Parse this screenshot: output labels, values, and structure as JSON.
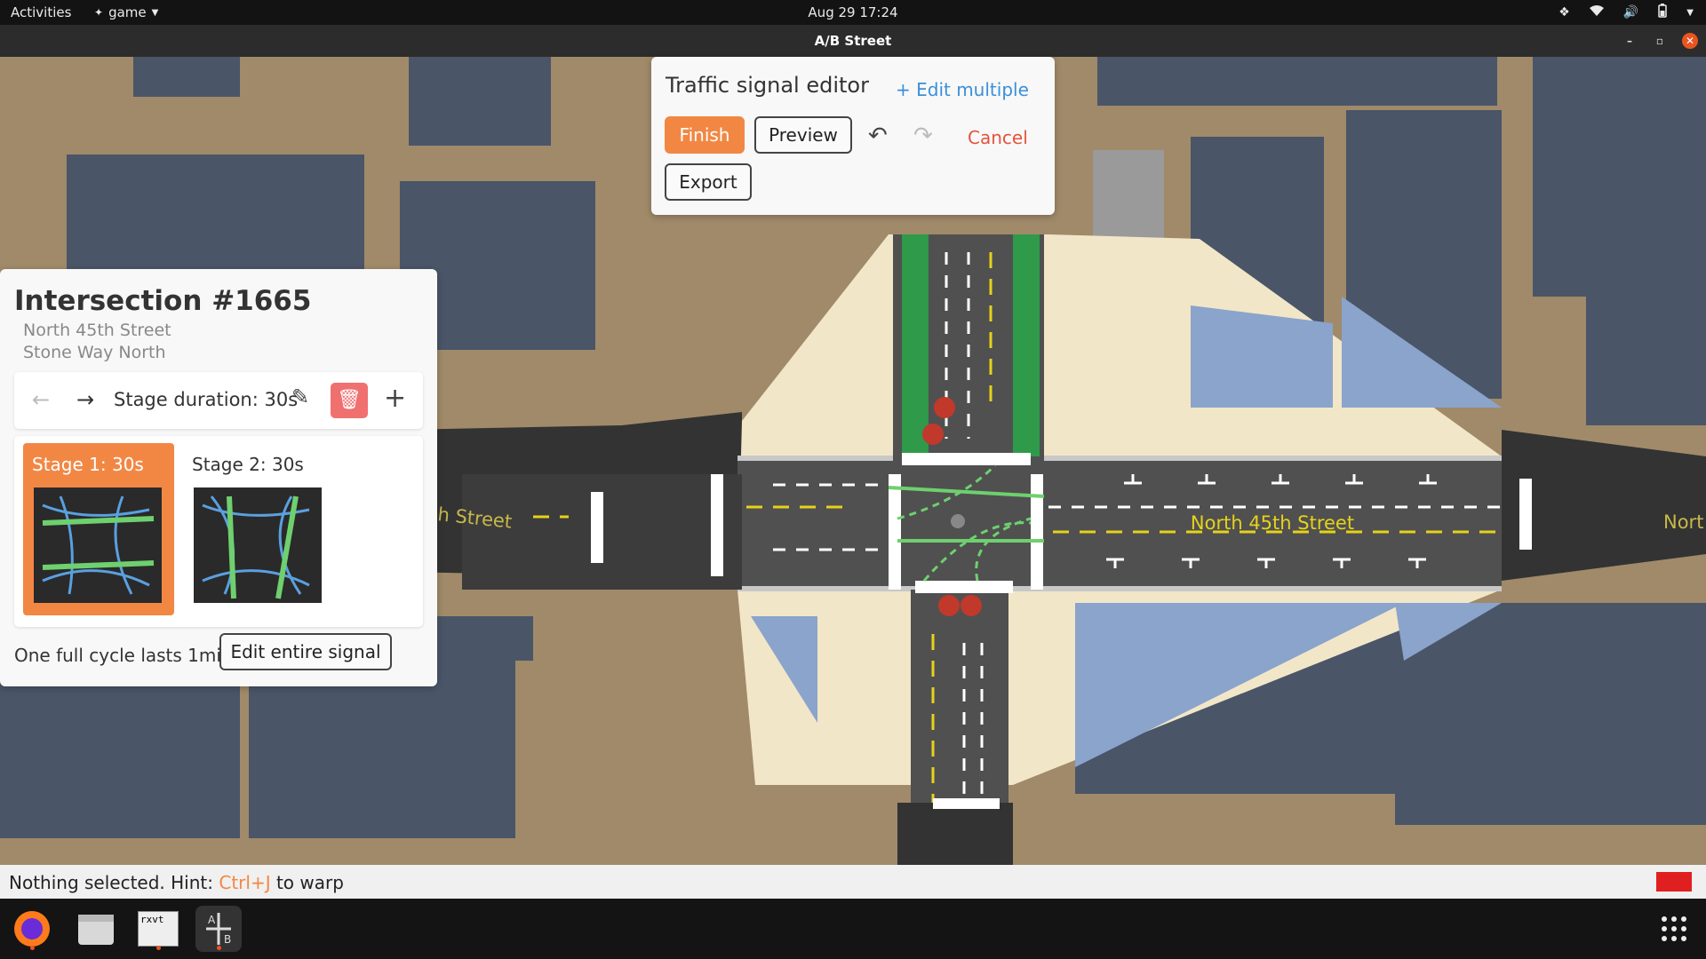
{
  "topbar": {
    "activities": "Activities",
    "app_name": "game",
    "clock": "Aug 29  17:24"
  },
  "window": {
    "title": "A/B Street"
  },
  "map": {
    "street_labels": [
      "North 45th Street",
      "h Street",
      "Nort"
    ]
  },
  "editor": {
    "title": "Traffic signal editor",
    "edit_multiple": "+ Edit multiple",
    "finish": "Finish",
    "preview": "Preview",
    "cancel": "Cancel",
    "export": "Export"
  },
  "intersection": {
    "title": "Intersection #1665",
    "streets": [
      "North 45th Street",
      "Stone Way North"
    ],
    "stage_duration": "Stage duration: 30s",
    "stages": [
      {
        "label": "Stage 1: 30s",
        "active": true
      },
      {
        "label": "Stage 2: 30s",
        "active": false
      }
    ],
    "cycle_text": "One full cycle lasts 1min",
    "edit_entire": "Edit entire signal"
  },
  "status": {
    "prefix": "Nothing selected. Hint: ",
    "key": "Ctrl+J",
    "suffix": " to warp"
  },
  "dock": {
    "terminal_label": "rxvt"
  },
  "colors": {
    "accent": "#f28744",
    "link": "#3b8fd9",
    "cancel": "#e5533d",
    "building": "#4a5568",
    "road": "#505050",
    "sidewalk": "#f2e6c8",
    "bike_lane": "#2e9a4a"
  }
}
